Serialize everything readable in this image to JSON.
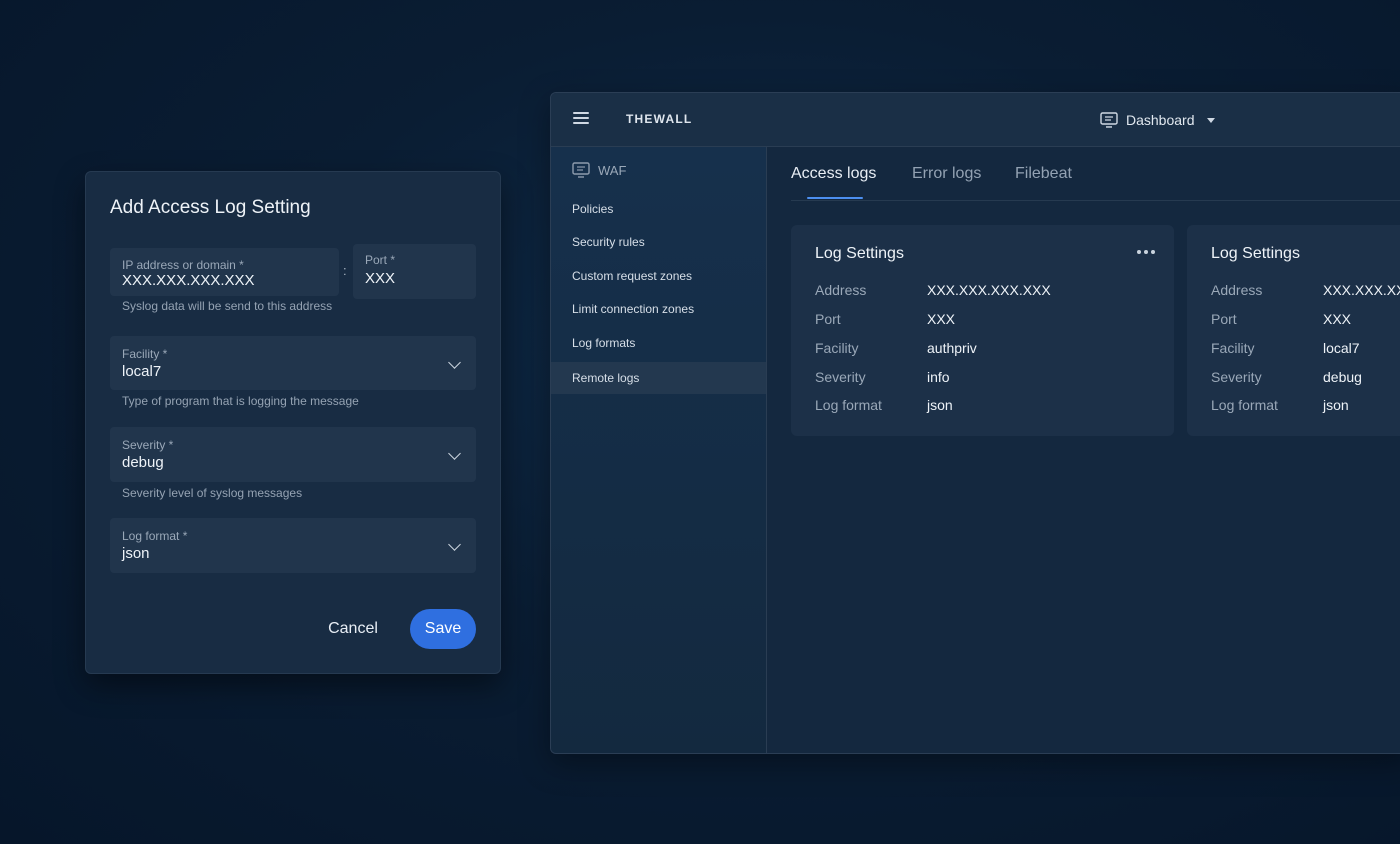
{
  "app": {
    "brand": "THEWALL",
    "dashboard_label": "Dashboard"
  },
  "sidebar": {
    "section": "WAF",
    "items": [
      {
        "label": "Policies"
      },
      {
        "label": "Security rules"
      },
      {
        "label": "Custom request zones"
      },
      {
        "label": "Limit connection zones"
      },
      {
        "label": "Log formats"
      },
      {
        "label": "Remote logs",
        "active": true
      }
    ]
  },
  "tabs": [
    {
      "label": "Access logs",
      "active": true
    },
    {
      "label": "Error logs"
    },
    {
      "label": "Filebeat"
    }
  ],
  "cards": [
    {
      "title": "Log Settings",
      "rows": [
        {
          "key": "Address",
          "value": "XXX.XXX.XXX.XXX"
        },
        {
          "key": "Port",
          "value": "XXX"
        },
        {
          "key": "Facility",
          "value": "authpriv"
        },
        {
          "key": "Severity",
          "value": "info"
        },
        {
          "key": "Log format",
          "value": "json"
        }
      ]
    },
    {
      "title": "Log Settings",
      "rows": [
        {
          "key": "Address",
          "value": "XXX.XXX.XX"
        },
        {
          "key": "Port",
          "value": "XXX"
        },
        {
          "key": "Facility",
          "value": "local7"
        },
        {
          "key": "Severity",
          "value": "debug"
        },
        {
          "key": "Log format",
          "value": "json"
        }
      ]
    }
  ],
  "dialog": {
    "title": "Add Access Log Setting",
    "address": {
      "label": "IP address or domain *",
      "value": "XXX.XXX.XXX.XXX",
      "helper": "Syslog data will be send to this address"
    },
    "separator": ":",
    "port": {
      "label": "Port *",
      "value": "XXX"
    },
    "facility": {
      "label": "Facility *",
      "value": "local7",
      "helper": "Type of program that is logging the message"
    },
    "severity": {
      "label": "Severity *",
      "value": "debug",
      "helper": "Severity level of syslog messages"
    },
    "log_format": {
      "label": "Log format *",
      "value": "json"
    },
    "cancel_label": "Cancel",
    "save_label": "Save"
  },
  "icons": {
    "menu": "hamburger-menu-icon",
    "dashboard": "monitor-icon",
    "waf": "monitor-icon",
    "more": "more-horizontal-icon",
    "dropdown": "chevron-down-icon"
  },
  "colors": {
    "accent": "#2f6fe0",
    "tab_indicator": "#4c8ff0"
  }
}
